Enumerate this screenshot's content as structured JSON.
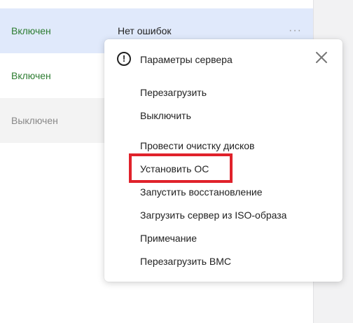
{
  "rows": [
    {
      "status": "Включен",
      "errors": "Нет ошибок",
      "more": "···"
    },
    {
      "status": "Включен",
      "errors": ""
    },
    {
      "status": "Выключен",
      "errors": ""
    }
  ],
  "menu": {
    "title": "Параметры сервера",
    "items": [
      "Перезагрузить",
      "Выключить",
      "Провести очистку дисков",
      "Установить ОС",
      "Запустить восстановление",
      "Загрузить сервер из ISO-образа",
      "Примечание",
      "Перезагрузить BMC"
    ]
  },
  "icons": {
    "info": "info-icon",
    "close": "close-icon",
    "more": "more-dots-icon"
  },
  "colors": {
    "status_on": "#2e7d32",
    "status_off": "#888888",
    "selected_row": "#e0e9fb",
    "highlight": "#e0222b"
  }
}
